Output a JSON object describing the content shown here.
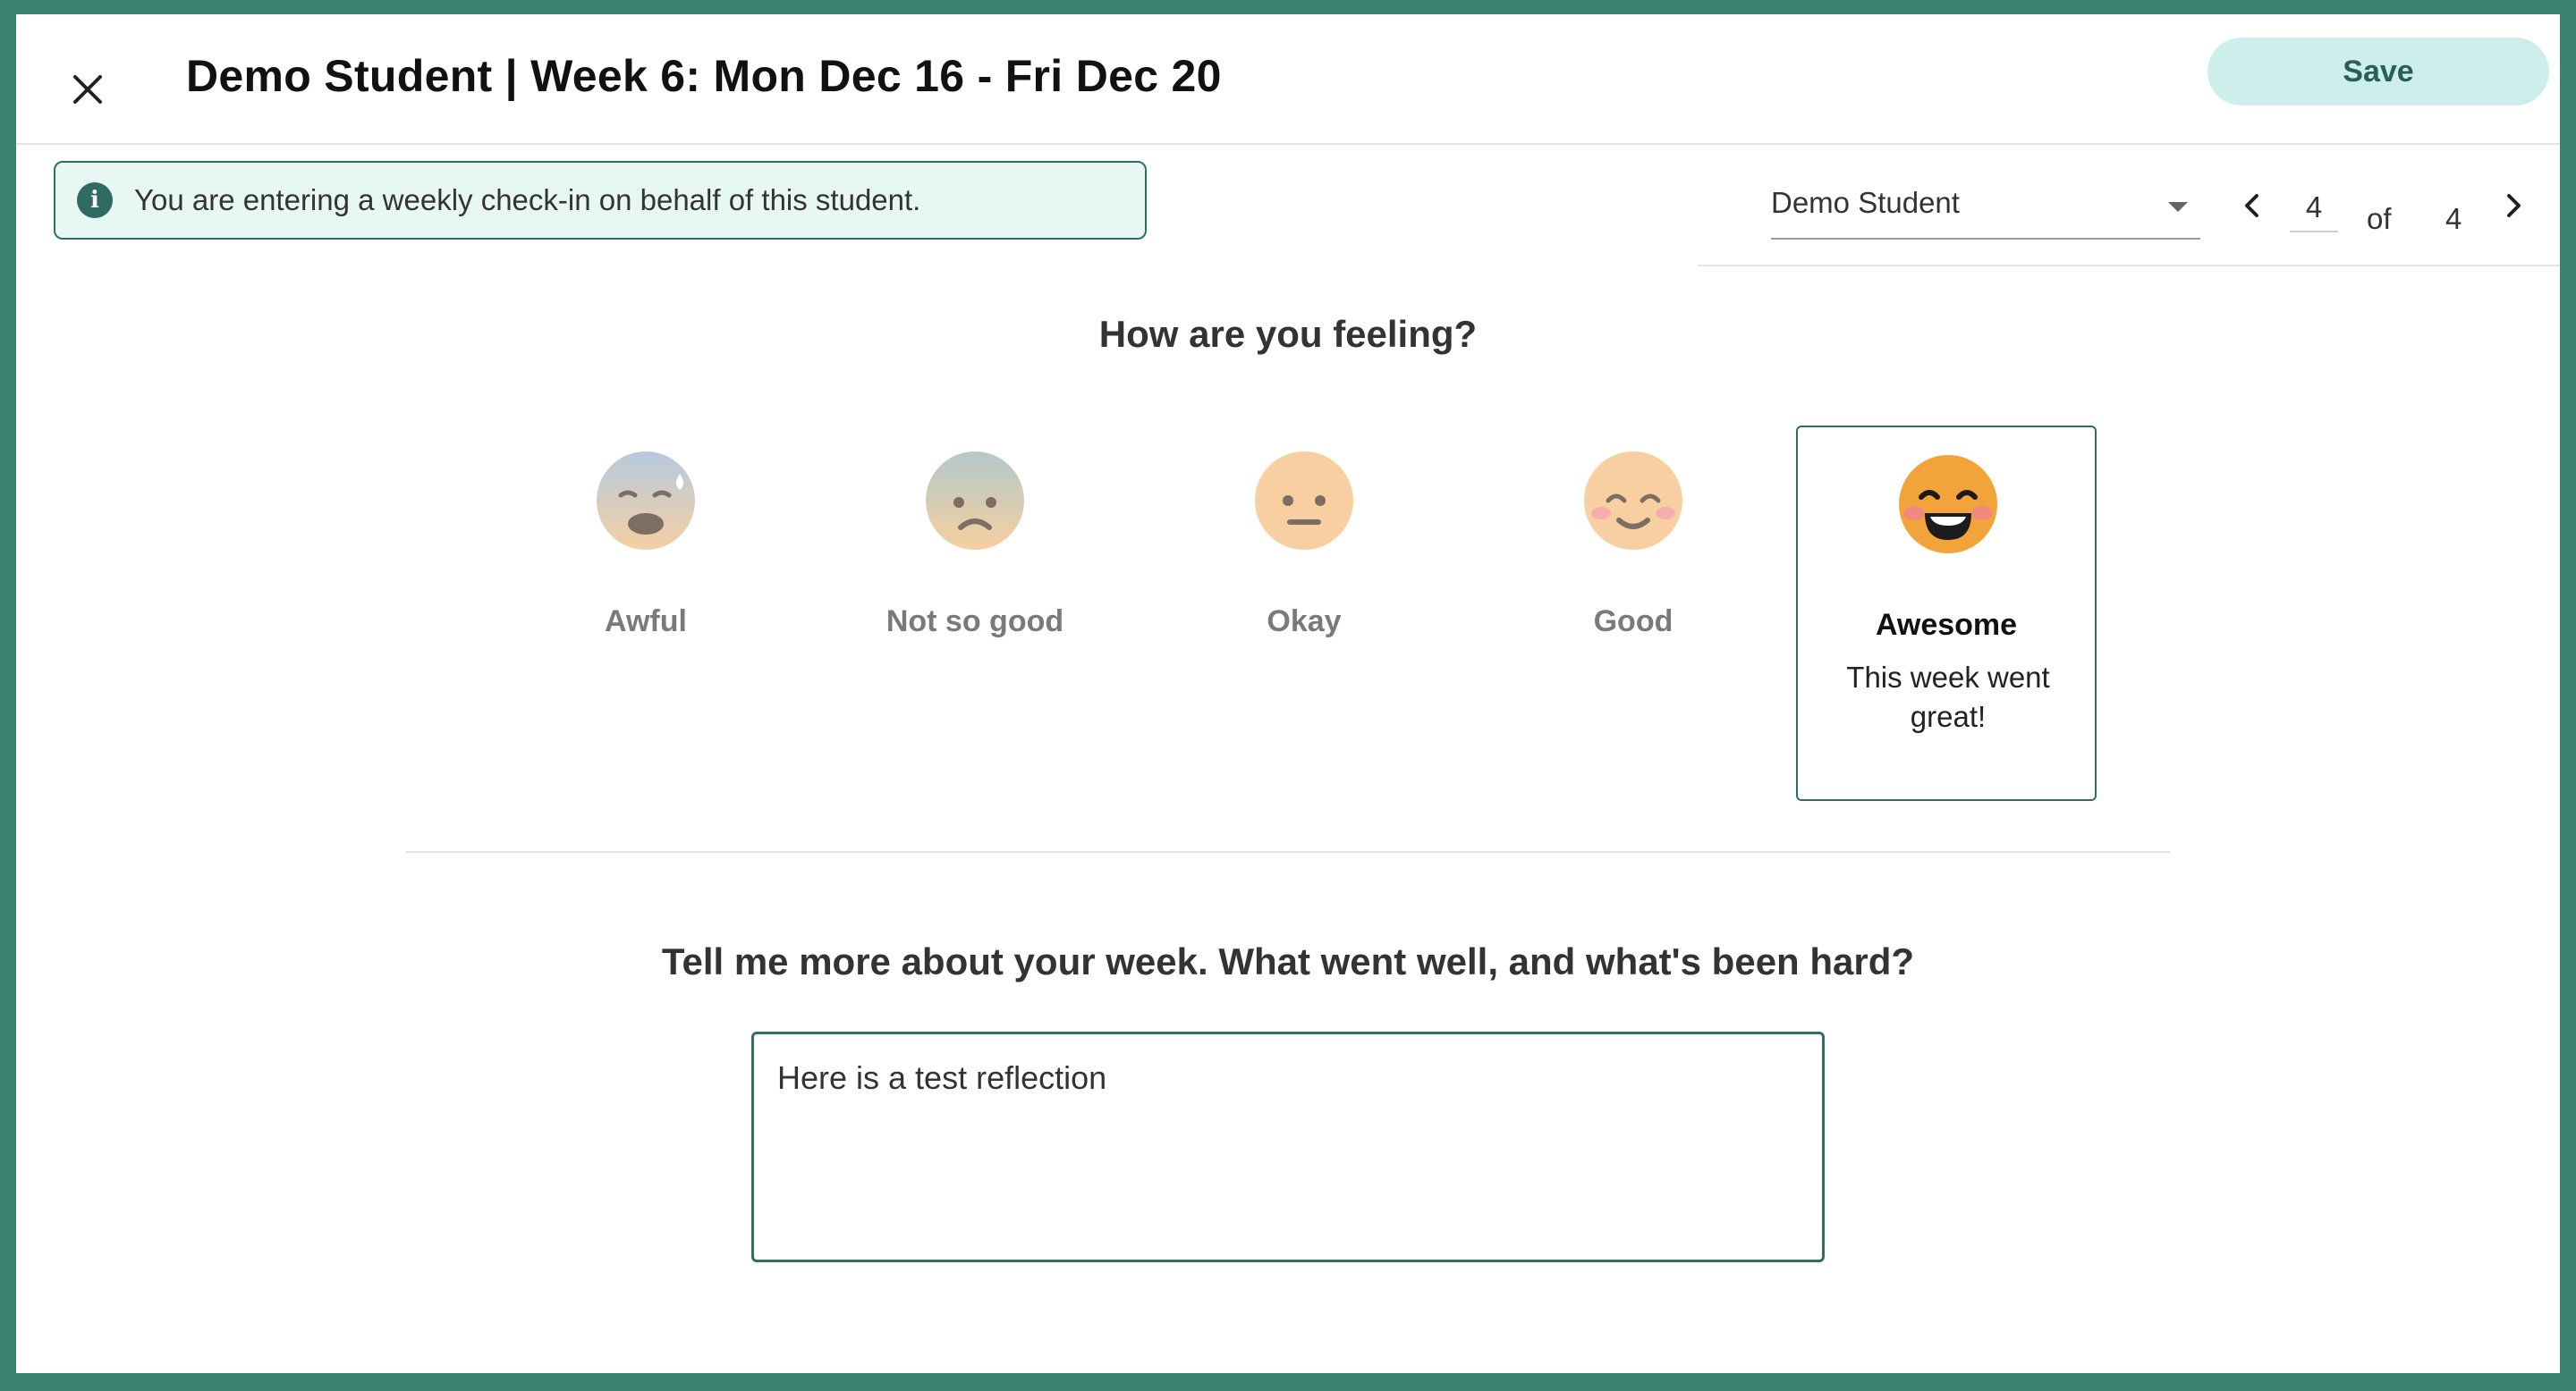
{
  "header": {
    "title": "Demo Student | Week 6: Mon Dec 16 - Fri Dec 20",
    "save_label": "Save",
    "close_icon": "close-icon"
  },
  "banner": {
    "icon": "info-icon",
    "icon_glyph": "i",
    "text": "You are entering a weekly check-in on behalf of this student."
  },
  "student_selector": {
    "selected": "Demo Student"
  },
  "pager": {
    "current": "4",
    "of_label": "of",
    "total": "4"
  },
  "feeling": {
    "question": "How are you feeling?",
    "options": [
      {
        "label": "Awful",
        "icon": "awful-face-icon"
      },
      {
        "label": "Not so good",
        "icon": "sad-face-icon"
      },
      {
        "label": "Okay",
        "icon": "neutral-face-icon"
      },
      {
        "label": "Good",
        "icon": "happy-face-icon"
      },
      {
        "label": "Awesome",
        "icon": "grinning-face-icon",
        "description": "This week went great!",
        "selected": true
      }
    ]
  },
  "reflection": {
    "question": "Tell me more about your week. What went well, and what's been hard?",
    "value": "Here is a test reflection"
  },
  "colors": {
    "frame": "#3b8270",
    "accent": "#2f6e66",
    "save_bg": "#cdeeea",
    "banner_bg": "#e7f7f4"
  }
}
